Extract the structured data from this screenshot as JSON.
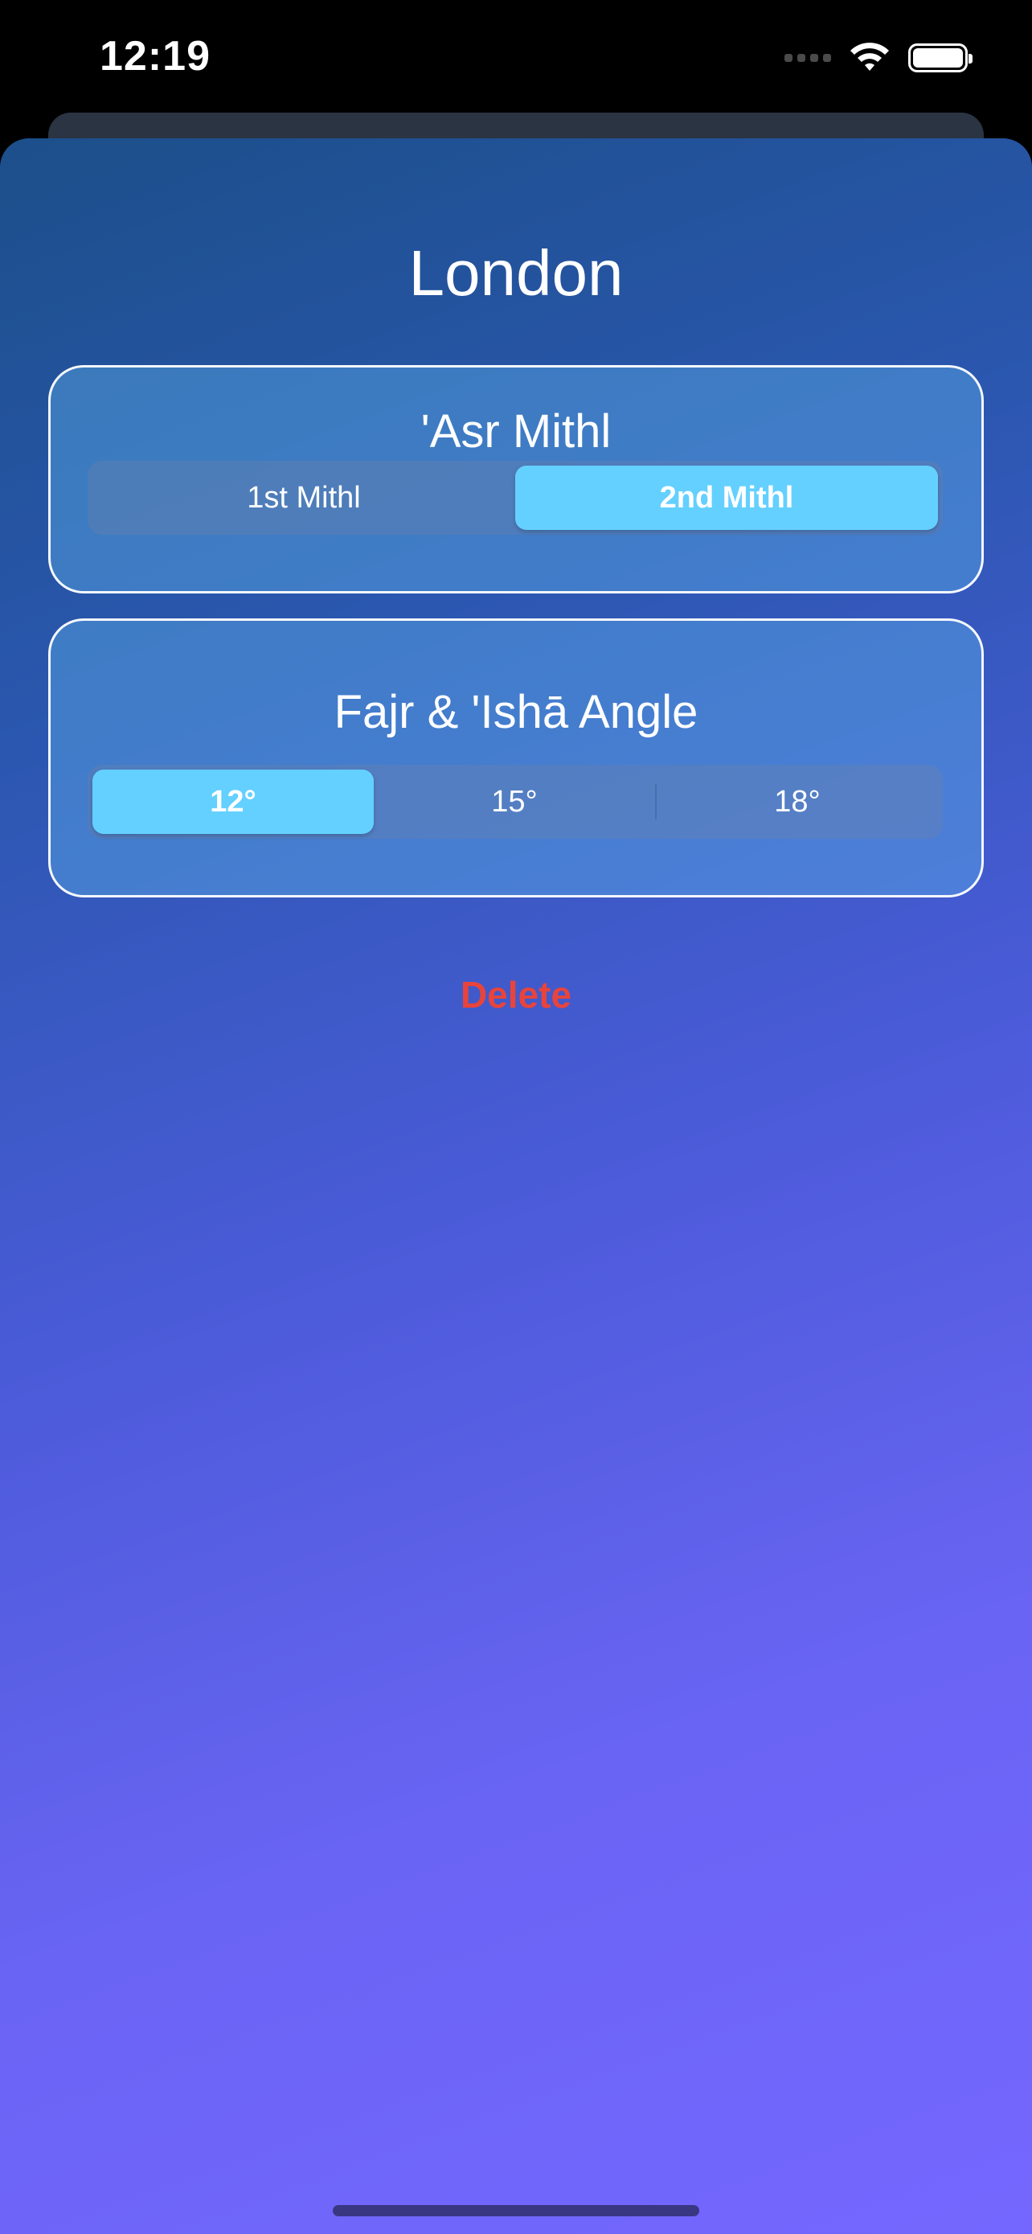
{
  "status_bar": {
    "time": "12:19"
  },
  "sheet": {
    "title": "London"
  },
  "asr_card": {
    "title": "'Asr Mithl",
    "options": [
      "1st Mithl",
      "2nd Mithl"
    ],
    "selected": "2nd Mithl"
  },
  "fajr_card": {
    "title": "Fajr & 'Ishā Angle",
    "options": [
      "12°",
      "15°",
      "18°"
    ],
    "selected": "12°"
  },
  "actions": {
    "delete_label": "Delete"
  },
  "colors": {
    "accent_selected": "#64d0ff",
    "destructive": "#e8443c",
    "gradient_top": "#1c4f8a",
    "gradient_bottom": "#7467ff"
  }
}
